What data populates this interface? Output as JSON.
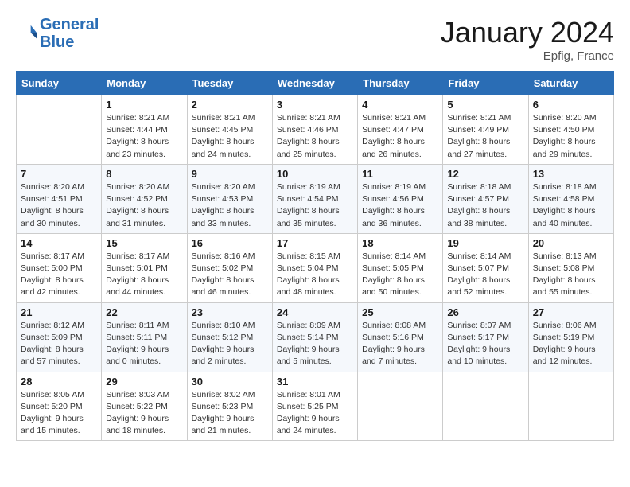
{
  "logo": {
    "line1": "General",
    "line2": "Blue"
  },
  "title": "January 2024",
  "location": "Epfig, France",
  "weekdays": [
    "Sunday",
    "Monday",
    "Tuesday",
    "Wednesday",
    "Thursday",
    "Friday",
    "Saturday"
  ],
  "weeks": [
    [
      {
        "num": "",
        "info": ""
      },
      {
        "num": "1",
        "info": "Sunrise: 8:21 AM\nSunset: 4:44 PM\nDaylight: 8 hours\nand 23 minutes."
      },
      {
        "num": "2",
        "info": "Sunrise: 8:21 AM\nSunset: 4:45 PM\nDaylight: 8 hours\nand 24 minutes."
      },
      {
        "num": "3",
        "info": "Sunrise: 8:21 AM\nSunset: 4:46 PM\nDaylight: 8 hours\nand 25 minutes."
      },
      {
        "num": "4",
        "info": "Sunrise: 8:21 AM\nSunset: 4:47 PM\nDaylight: 8 hours\nand 26 minutes."
      },
      {
        "num": "5",
        "info": "Sunrise: 8:21 AM\nSunset: 4:49 PM\nDaylight: 8 hours\nand 27 minutes."
      },
      {
        "num": "6",
        "info": "Sunrise: 8:20 AM\nSunset: 4:50 PM\nDaylight: 8 hours\nand 29 minutes."
      }
    ],
    [
      {
        "num": "7",
        "info": ""
      },
      {
        "num": "8",
        "info": "Sunrise: 8:20 AM\nSunset: 4:52 PM\nDaylight: 8 hours\nand 31 minutes."
      },
      {
        "num": "9",
        "info": "Sunrise: 8:20 AM\nSunset: 4:53 PM\nDaylight: 8 hours\nand 33 minutes."
      },
      {
        "num": "10",
        "info": "Sunrise: 8:19 AM\nSunset: 4:54 PM\nDaylight: 8 hours\nand 35 minutes."
      },
      {
        "num": "11",
        "info": "Sunrise: 8:19 AM\nSunset: 4:56 PM\nDaylight: 8 hours\nand 36 minutes."
      },
      {
        "num": "12",
        "info": "Sunrise: 8:18 AM\nSunset: 4:57 PM\nDaylight: 8 hours\nand 38 minutes."
      },
      {
        "num": "13",
        "info": "Sunrise: 8:18 AM\nSunset: 4:58 PM\nDaylight: 8 hours\nand 40 minutes."
      }
    ],
    [
      {
        "num": "14",
        "info": ""
      },
      {
        "num": "15",
        "info": "Sunrise: 8:17 AM\nSunset: 5:01 PM\nDaylight: 8 hours\nand 44 minutes."
      },
      {
        "num": "16",
        "info": "Sunrise: 8:16 AM\nSunset: 5:02 PM\nDaylight: 8 hours\nand 46 minutes."
      },
      {
        "num": "17",
        "info": "Sunrise: 8:15 AM\nSunset: 5:04 PM\nDaylight: 8 hours\nand 48 minutes."
      },
      {
        "num": "18",
        "info": "Sunrise: 8:14 AM\nSunset: 5:05 PM\nDaylight: 8 hours\nand 50 minutes."
      },
      {
        "num": "19",
        "info": "Sunrise: 8:14 AM\nSunset: 5:07 PM\nDaylight: 8 hours\nand 52 minutes."
      },
      {
        "num": "20",
        "info": "Sunrise: 8:13 AM\nSunset: 5:08 PM\nDaylight: 8 hours\nand 55 minutes."
      }
    ],
    [
      {
        "num": "21",
        "info": ""
      },
      {
        "num": "22",
        "info": "Sunrise: 8:11 AM\nSunset: 5:11 PM\nDaylight: 9 hours\nand 0 minutes."
      },
      {
        "num": "23",
        "info": "Sunrise: 8:10 AM\nSunset: 5:12 PM\nDaylight: 9 hours\nand 2 minutes."
      },
      {
        "num": "24",
        "info": "Sunrise: 8:09 AM\nSunset: 5:14 PM\nDaylight: 9 hours\nand 5 minutes."
      },
      {
        "num": "25",
        "info": "Sunrise: 8:08 AM\nSunset: 5:16 PM\nDaylight: 9 hours\nand 7 minutes."
      },
      {
        "num": "26",
        "info": "Sunrise: 8:07 AM\nSunset: 5:17 PM\nDaylight: 9 hours\nand 10 minutes."
      },
      {
        "num": "27",
        "info": "Sunrise: 8:06 AM\nSunset: 5:19 PM\nDaylight: 9 hours\nand 12 minutes."
      }
    ],
    [
      {
        "num": "28",
        "info": ""
      },
      {
        "num": "29",
        "info": "Sunrise: 8:03 AM\nSunset: 5:22 PM\nDaylight: 9 hours\nand 18 minutes."
      },
      {
        "num": "30",
        "info": "Sunrise: 8:02 AM\nSunset: 5:23 PM\nDaylight: 9 hours\nand 21 minutes."
      },
      {
        "num": "31",
        "info": "Sunrise: 8:01 AM\nSunset: 5:25 PM\nDaylight: 9 hours\nand 24 minutes."
      },
      {
        "num": "",
        "info": ""
      },
      {
        "num": "",
        "info": ""
      },
      {
        "num": "",
        "info": ""
      }
    ]
  ],
  "week1_sun_info": "Sunrise: 8:20 AM\nSunset: 4:51 PM\nDaylight: 8 hours\nand 30 minutes.",
  "week3_sun_info": "Sunrise: 8:17 AM\nSunset: 5:00 PM\nDaylight: 8 hours\nand 42 minutes.",
  "week4_sun_info": "Sunrise: 8:12 AM\nSunset: 5:09 PM\nDaylight: 8 hours\nand 57 minutes.",
  "week5_sun_info": "Sunrise: 8:05 AM\nSunset: 5:20 PM\nDaylight: 9 hours\nand 15 minutes."
}
